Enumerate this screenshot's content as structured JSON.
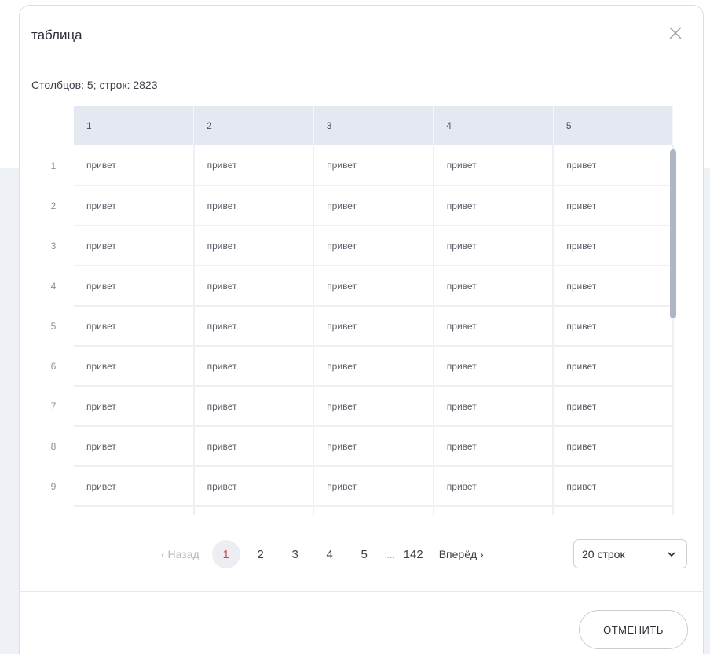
{
  "modal": {
    "title": "таблица",
    "summary": "Столбцов: 5; строк: 2823"
  },
  "table": {
    "headers": [
      "1",
      "2",
      "3",
      "4",
      "5"
    ],
    "rows": [
      {
        "index": "1",
        "cells": [
          "привет",
          "привет",
          "привет",
          "привет",
          "привет"
        ]
      },
      {
        "index": "2",
        "cells": [
          "привет",
          "привет",
          "привет",
          "привет",
          "привет"
        ]
      },
      {
        "index": "3",
        "cells": [
          "привет",
          "привет",
          "привет",
          "привет",
          "привет"
        ]
      },
      {
        "index": "4",
        "cells": [
          "привет",
          "привет",
          "привет",
          "привет",
          "привет"
        ]
      },
      {
        "index": "5",
        "cells": [
          "привет",
          "привет",
          "привет",
          "привет",
          "привет"
        ]
      },
      {
        "index": "6",
        "cells": [
          "привет",
          "привет",
          "привет",
          "привет",
          "привет"
        ]
      },
      {
        "index": "7",
        "cells": [
          "привет",
          "привет",
          "привет",
          "привет",
          "привет"
        ]
      },
      {
        "index": "8",
        "cells": [
          "привет",
          "привет",
          "привет",
          "привет",
          "привет"
        ]
      },
      {
        "index": "9",
        "cells": [
          "привет",
          "привет",
          "привет",
          "привет",
          "привет"
        ]
      },
      {
        "index": "",
        "cells": [
          "",
          "",
          "",
          "",
          ""
        ]
      }
    ]
  },
  "pagination": {
    "prev_label": "‹ Назад",
    "pages": [
      "1",
      "2",
      "3",
      "4",
      "5"
    ],
    "active_page": "1",
    "ellipsis": "...",
    "last_page": "142",
    "next_label": "Вперёд ›"
  },
  "rows_select": {
    "value": "20 строк"
  },
  "footer": {
    "cancel_label": "ОТМЕНИТЬ"
  },
  "colors": {
    "active_page": "#e0434f",
    "header_bg": "#e4e9f1",
    "backdrop": "#eef1f6"
  },
  "icons": {
    "close": "close-icon",
    "chevron": "chevron-down-icon"
  }
}
